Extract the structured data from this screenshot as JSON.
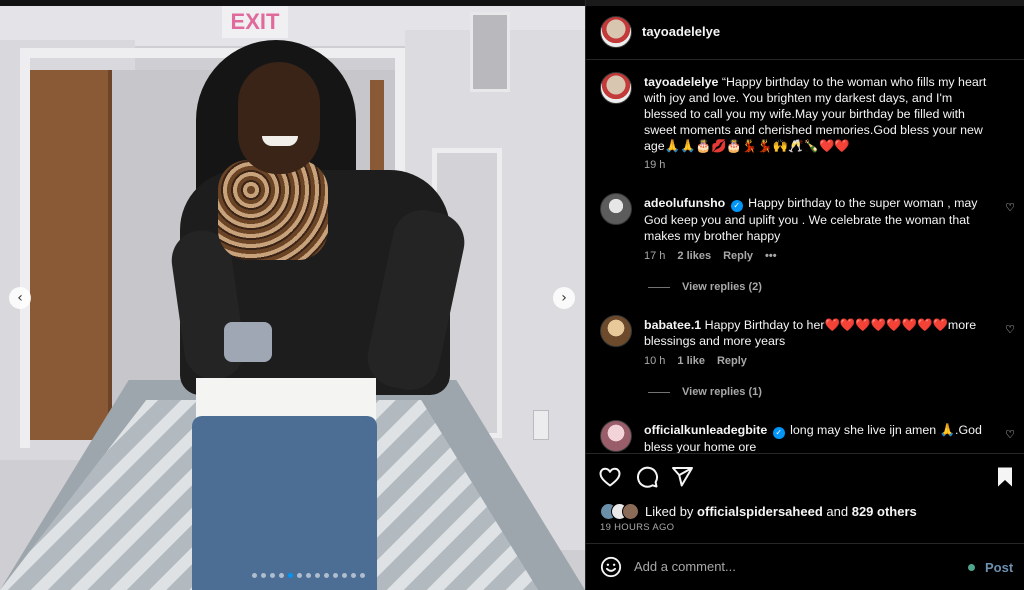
{
  "post": {
    "author": "tayoadelelye",
    "caption_user": "tayoadelelye",
    "caption": "“Happy birthday to the woman who fills my heart with joy and love. You brighten my darkest days, and I'm blessed to call you my wife.May your birthday be filled with sweet moments and cherished memories.God bless your new age🙏🙏🎂💋🎂💃💃🙌🥂🍾❤️❤️",
    "caption_time": "19 h",
    "exit_sign": "EXIT",
    "nav_prev": "‹",
    "nav_next": "›"
  },
  "comments": [
    {
      "user": "adeolufunsho",
      "verified": true,
      "text": "Happy birthday to the super woman , may God keep you and uplift you . We celebrate the woman that makes my brother happy",
      "time": "17 h",
      "likes": "2 likes",
      "reply": "Reply",
      "more": "•••",
      "view_replies": "View replies (2)"
    },
    {
      "user": "babatee.1",
      "verified": false,
      "text": "Happy Birthday to her❤️❤️❤️❤️❤️❤️❤️❤️more blessings and more years",
      "time": "10 h",
      "likes": "1 like",
      "reply": "Reply",
      "view_replies": "View replies (1)"
    },
    {
      "user": "officialkunleadegbite",
      "verified": true,
      "text": "long may she live ijn amen 🙏.God bless your home ore"
    }
  ],
  "icons": {
    "verified": "✓",
    "heart_small": "♡"
  },
  "engagement": {
    "liked_by_prefix": "Liked by",
    "liked_by_user": "officialspidersaheed",
    "and": "and",
    "others": "829 others",
    "time_ago": "19 HOURS AGO"
  },
  "comment_box": {
    "placeholder": "Add a comment...",
    "post_label": "Post"
  },
  "colors": {
    "accent": "#0095f6",
    "post_button": "#6d8fb0",
    "status_dot": "#4fa68c"
  }
}
